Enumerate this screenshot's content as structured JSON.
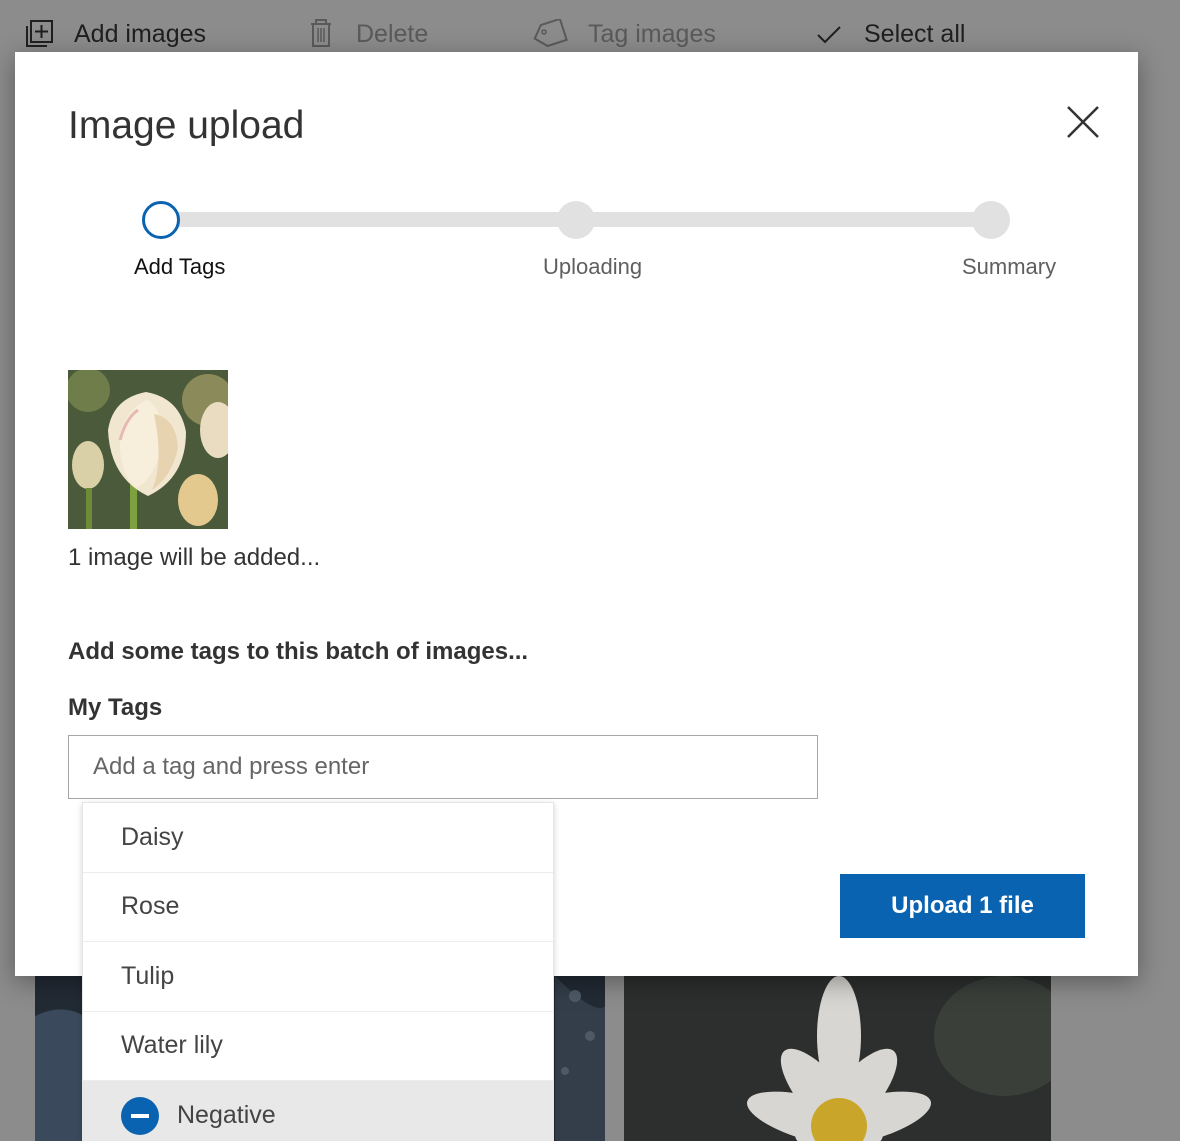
{
  "toolbar": {
    "add_images": "Add images",
    "delete": "Delete",
    "tag_images": "Tag images",
    "select_all": "Select all"
  },
  "modal": {
    "title": "Image upload",
    "stepper": {
      "steps": [
        "Add Tags",
        "Uploading",
        "Summary"
      ],
      "active_step": 0
    },
    "image_count_text": "1 image will be added...",
    "tags_heading": "Add some tags to this batch of images...",
    "tags_label": "My Tags",
    "tag_input": {
      "value": "",
      "placeholder": "Add a tag and press enter"
    },
    "upload_button": "Upload 1 file"
  },
  "dropdown": {
    "items": [
      "Daisy",
      "Rose",
      "Tulip",
      "Water lily"
    ],
    "negative_item": "Negative"
  },
  "colors": {
    "accent": "#0a63b0",
    "overlay": "#8c8c8c"
  },
  "icons": [
    "add-images-icon",
    "trash-icon",
    "tag-icon",
    "checkmark-icon",
    "close-icon",
    "minus-circle-icon"
  ]
}
